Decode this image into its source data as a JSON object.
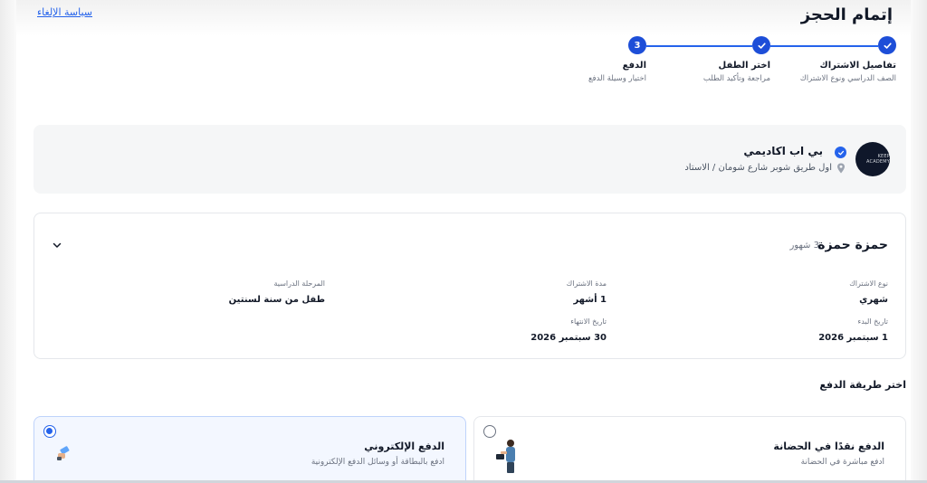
{
  "header": {
    "title": "إتمام الحجز",
    "cancel_policy": "سياسة الإلغاء"
  },
  "stepper": {
    "steps": [
      {
        "title": "تفاصيل الاشتراك",
        "subtitle": "الصف الدراسي ونوع الاشتراك",
        "state": "done"
      },
      {
        "title": "اختر الطفل",
        "subtitle": "مراجعة وتأكيد الطلب",
        "state": "done"
      },
      {
        "title": "الدفع",
        "subtitle": "اختيار وسيلة الدفع",
        "state": "current",
        "number": "3"
      }
    ]
  },
  "provider": {
    "logo_text": "KEEP ACADEMY",
    "name": "بي اب اكاديمي",
    "address": "اول طريق شوبر شارع شومان / الاستاد"
  },
  "subscription": {
    "child_name": "حمزة حمزة",
    "duration_badge": "3 شهور",
    "fields": {
      "type": {
        "label": "نوع الاشتراك",
        "value": "شهري"
      },
      "period": {
        "label": "مدة الاشتراك",
        "value": "1 أشهر"
      },
      "stage": {
        "label": "المرحلة الدراسية",
        "value": "طفل من سنة لسنتين"
      },
      "start": {
        "label": "تاريخ البدء",
        "value": "1 سبتمبر 2026"
      },
      "end": {
        "label": "تاريخ الانتهاء",
        "value": "30 سبتمبر 2026"
      }
    }
  },
  "payment": {
    "section_title": "اختر طريقة الدفع",
    "cash": {
      "title": "الدفع نقدًا في الحضانة",
      "description": "ادفع مباشرة في الحضانة",
      "selected": false
    },
    "online": {
      "title": "الدفع الإلكتروني",
      "description": "ادفع بالبطاقة أو وسائل الدفع الإلكترونية",
      "selected": true
    }
  },
  "colors": {
    "accent": "#2563eb",
    "step": "#1d4ed8"
  }
}
